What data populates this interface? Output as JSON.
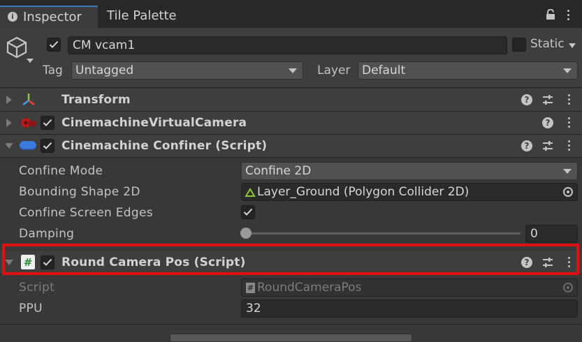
{
  "tabs": {
    "inspector": "Inspector",
    "tile_palette": "Tile Palette"
  },
  "header": {
    "object_name": "CM vcam1",
    "static_label": "Static",
    "tag_label": "Tag",
    "tag_value": "Untagged",
    "layer_label": "Layer",
    "layer_value": "Default"
  },
  "components": {
    "transform": "Transform",
    "vcam": "CinemachineVirtualCamera",
    "confiner": "Cinemachine Confiner (Script)",
    "round": "Round Camera Pos (Script)"
  },
  "confiner": {
    "confine_mode_label": "Confine Mode",
    "confine_mode_value": "Confine 2D",
    "bounding_label": "Bounding Shape 2D",
    "bounding_value": "Layer_Ground (Polygon Collider 2D)",
    "edges_label": "Confine Screen Edges",
    "damping_label": "Damping",
    "damping_value": "0"
  },
  "round": {
    "script_label": "Script",
    "script_value": "RoundCameraPos",
    "ppu_label": "PPU",
    "ppu_value": "32"
  },
  "icons": {
    "help": "?"
  },
  "colors": {
    "highlight": "#e01010",
    "tab_accent": "#3a79bb",
    "checkmark": "#d8d8d8"
  }
}
